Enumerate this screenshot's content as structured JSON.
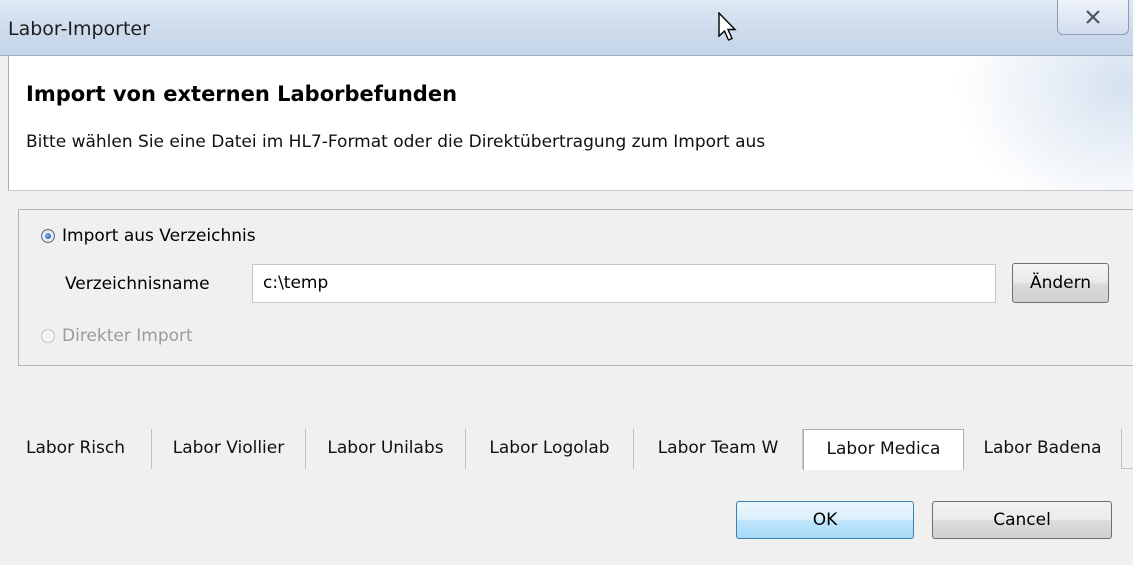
{
  "window": {
    "title": "Labor-Importer",
    "close_icon": "close-icon"
  },
  "header": {
    "title": "Import von externen Laborbefunden",
    "description": "Bitte wählen Sie eine Datei im HL7-Format oder die Direktübertragung zum Import aus"
  },
  "import_options": {
    "directory_option_label": "Import aus Verzeichnis",
    "directory_option_selected": true,
    "directory_name_label": "Verzeichnisname",
    "directory_name_value": "c:\\temp",
    "change_button_label": "Ändern",
    "direct_import_label": "Direkter Import",
    "direct_import_enabled": false
  },
  "tabs": [
    {
      "label": "Labor Risch",
      "active": false
    },
    {
      "label": "Labor Viollier",
      "active": false
    },
    {
      "label": "Labor Unilabs",
      "active": false
    },
    {
      "label": "Labor Logolab",
      "active": false
    },
    {
      "label": "Labor Team W",
      "active": false
    },
    {
      "label": "Labor Medica",
      "active": true
    },
    {
      "label": "Labor Badena",
      "active": false
    }
  ],
  "buttons": {
    "ok_label": "OK",
    "cancel_label": "Cancel"
  },
  "colors": {
    "title_bar": "#cddbec",
    "ok_button_accent": "#bee6fd",
    "dialog_background": "#f0f0f0"
  }
}
